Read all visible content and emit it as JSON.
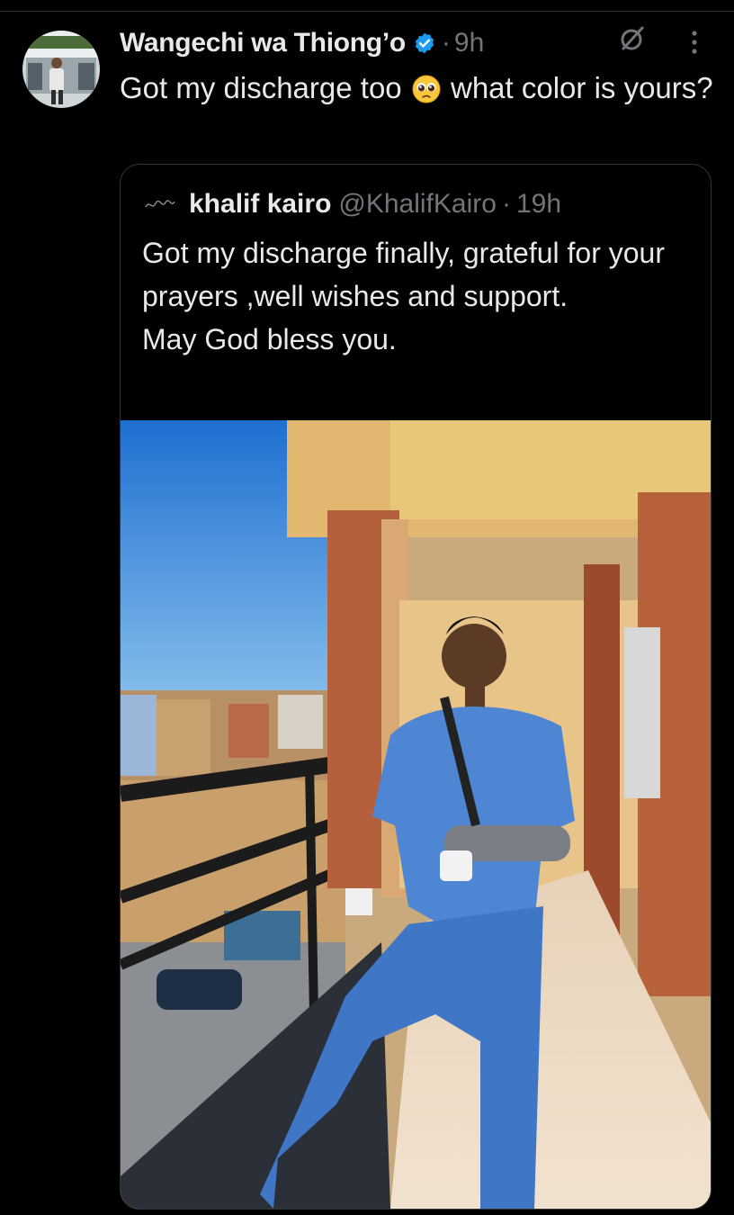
{
  "tweet": {
    "author_name": "Wangechi wa Thiong’o",
    "separator": "·",
    "time": "9h",
    "text_before_emoji": "Got my discharge too ",
    "emoji": "pleading-face",
    "text_after_emoji": " what color is yours?",
    "icons": {
      "verified": "verified-badge-icon",
      "grok": "grok-icon",
      "more": "more-options-icon"
    }
  },
  "quoted_tweet": {
    "author_name": "khalif kairo",
    "handle": "@KhalifKairo",
    "separator": "·",
    "time": "19h",
    "text": "Got my discharge finally, grateful for your prayers ,well wishes and support.\nMay God bless you."
  },
  "colors": {
    "background": "#000000",
    "text": "#e7e9ea",
    "secondary_text": "#71767b",
    "verified_blue": "#1d9bf0",
    "border": "#333639"
  }
}
